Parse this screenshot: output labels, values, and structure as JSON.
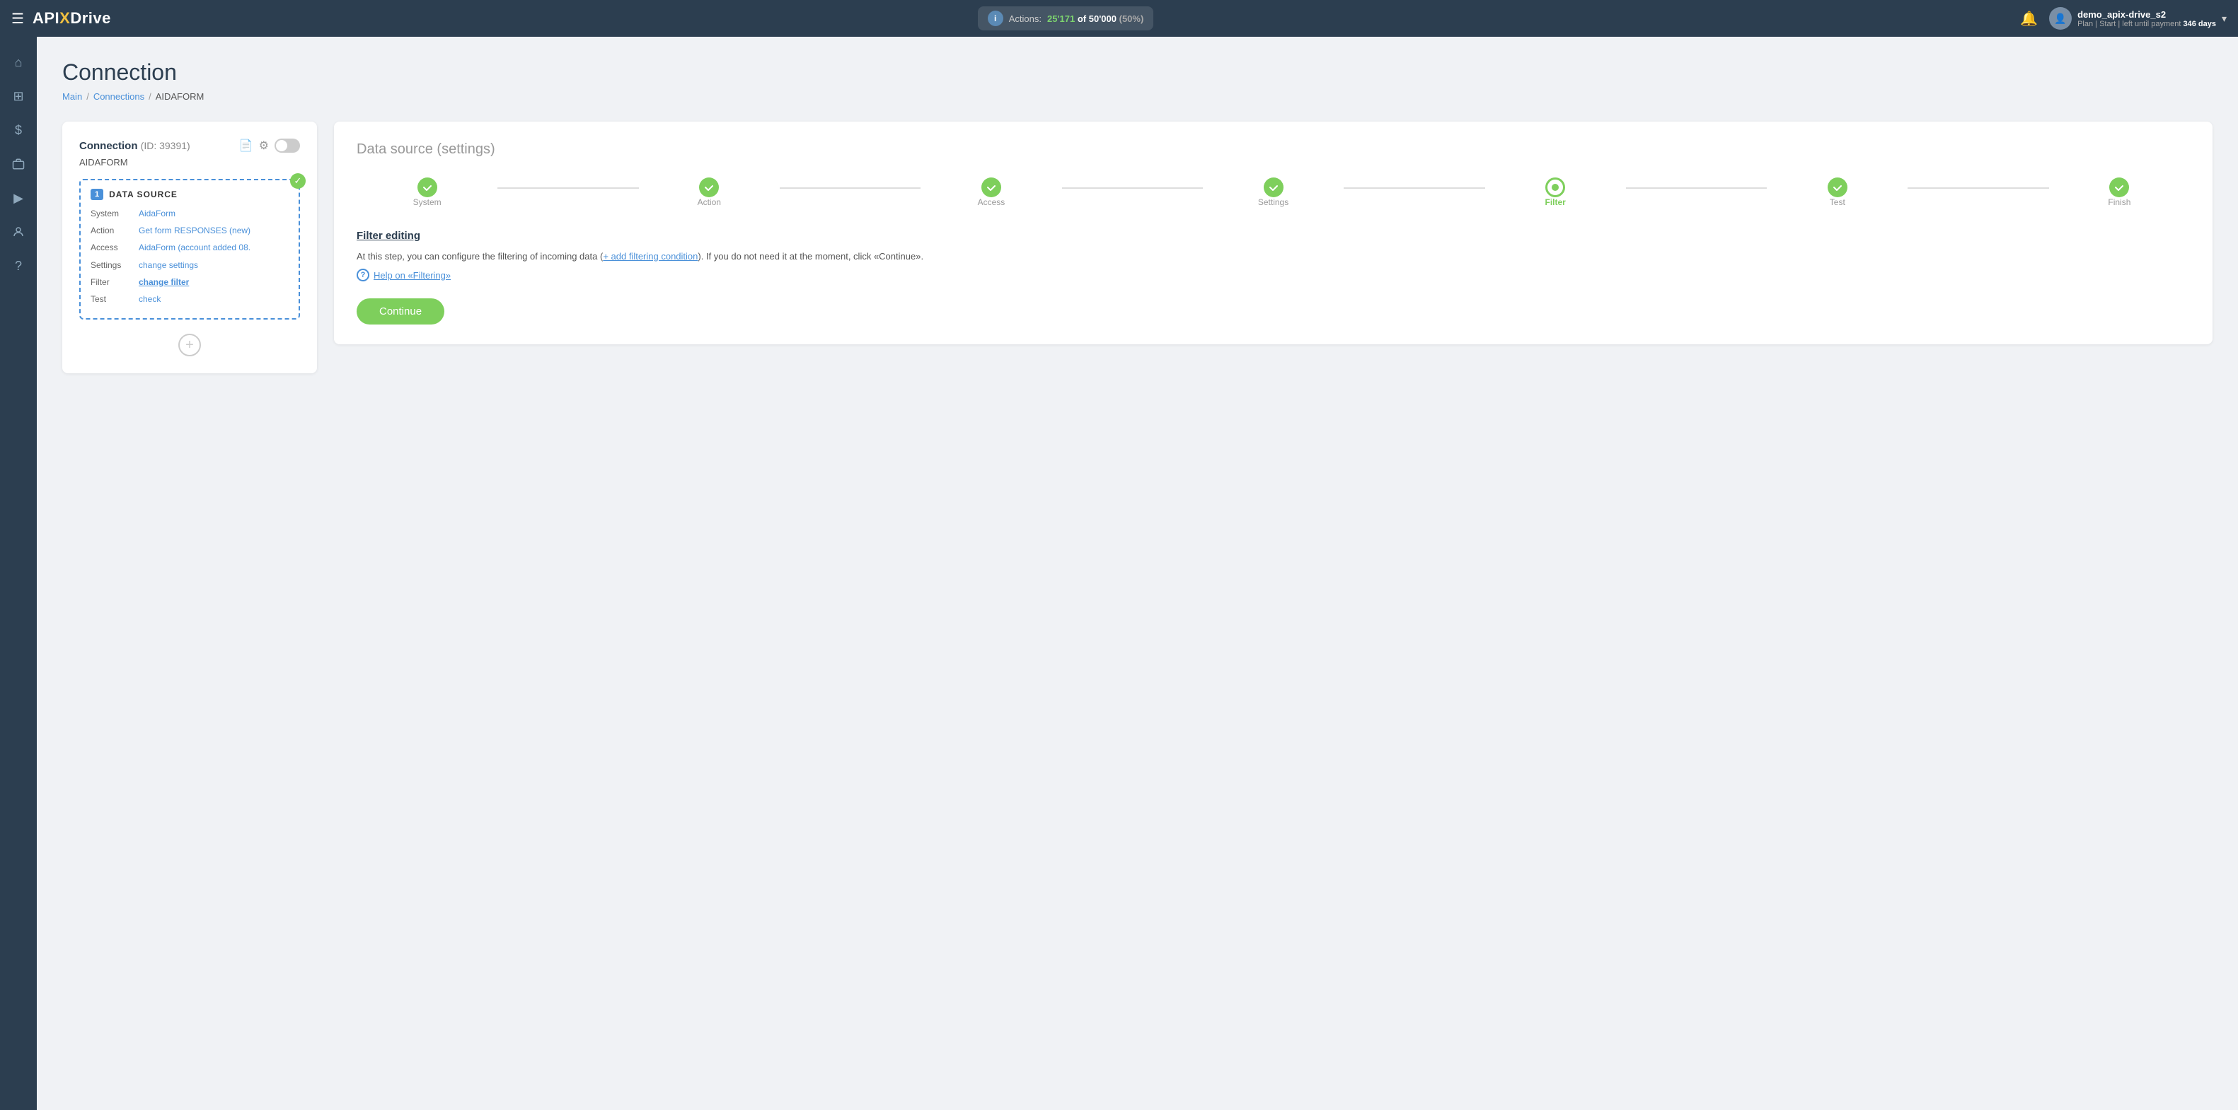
{
  "topnav": {
    "hamburger": "☰",
    "logo": "API",
    "logo_x": "X",
    "logo_drive": "Drive",
    "actions_label": "Actions:",
    "actions_used": "25'171",
    "actions_of": "of",
    "actions_total": "50'000",
    "actions_pct": "(50%)",
    "bell_icon": "🔔",
    "user_avatar": "👤",
    "user_name": "demo_apix-drive_s2",
    "user_plan": "Plan | Start | left until payment",
    "user_days": "346 days",
    "chevron": "▾"
  },
  "sidebar": {
    "items": [
      {
        "icon": "⌂",
        "label": "home-icon"
      },
      {
        "icon": "⊞",
        "label": "grid-icon"
      },
      {
        "icon": "$",
        "label": "dollar-icon"
      },
      {
        "icon": "💼",
        "label": "briefcase-icon"
      },
      {
        "icon": "▶",
        "label": "play-icon"
      },
      {
        "icon": "👤",
        "label": "user-icon"
      },
      {
        "icon": "?",
        "label": "help-icon"
      }
    ]
  },
  "page": {
    "title": "Connection",
    "breadcrumb": {
      "main": "Main",
      "connections": "Connections",
      "current": "AIDAFORM"
    }
  },
  "left_card": {
    "title": "Connection",
    "id_label": "(ID: 39391)",
    "doc_icon": "📄",
    "gear_icon": "⚙",
    "connection_name": "AIDAFORM",
    "datasource_num": "1",
    "datasource_label": "DATA SOURCE",
    "rows": [
      {
        "key": "System",
        "value": "AidaForm",
        "bold": false
      },
      {
        "key": "Action",
        "value": "Get form RESPONSES (new)",
        "bold": false
      },
      {
        "key": "Access",
        "value": "AidaForm (account added 08.",
        "bold": false
      },
      {
        "key": "Settings",
        "value": "change settings",
        "bold": false
      },
      {
        "key": "Filter",
        "value": "change filter",
        "bold": true
      },
      {
        "key": "Test",
        "value": "check",
        "bold": false
      }
    ],
    "add_btn": "+"
  },
  "right_card": {
    "title": "Data source",
    "title_sub": "(settings)",
    "steps": [
      {
        "label": "System",
        "state": "done"
      },
      {
        "label": "Action",
        "state": "done"
      },
      {
        "label": "Access",
        "state": "done"
      },
      {
        "label": "Settings",
        "state": "done"
      },
      {
        "label": "Filter",
        "state": "active"
      },
      {
        "label": "Test",
        "state": "done"
      },
      {
        "label": "Finish",
        "state": "done"
      }
    ],
    "section_title": "Filter editing",
    "section_desc_1": "At this step, you can configure the filtering of incoming data (",
    "section_desc_link": "+ add filtering condition",
    "section_desc_2": "). If you do not need it at the moment, click «Continue».",
    "help_link": "Help on «Filtering»",
    "continue_label": "Continue"
  }
}
